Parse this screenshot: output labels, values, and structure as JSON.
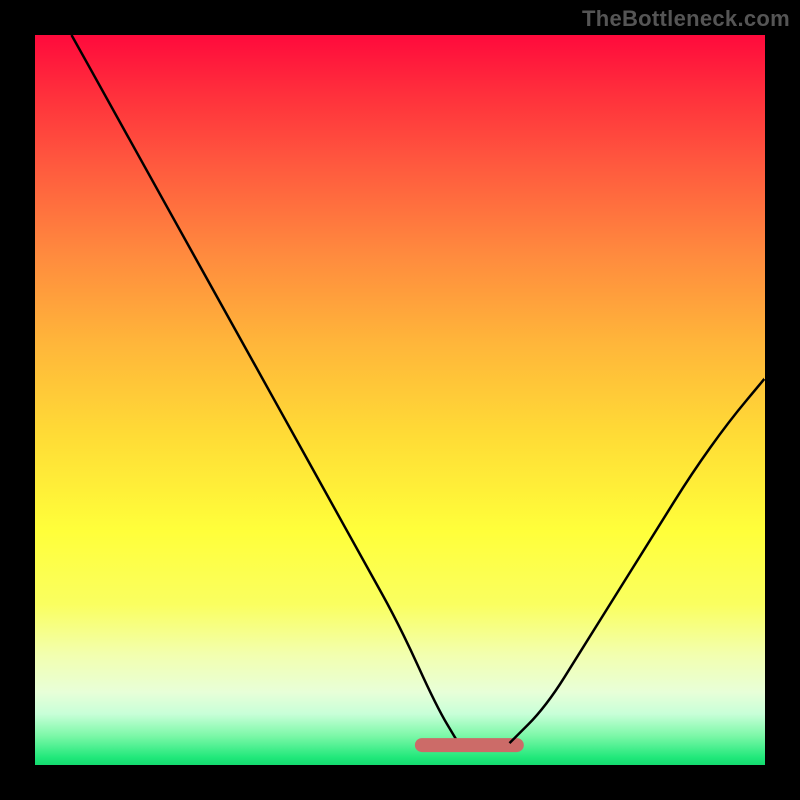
{
  "watermark": "TheBottleneck.com",
  "colors": {
    "gradient_top": "#ff0a3c",
    "gradient_bottom": "#14da6f",
    "valley_stroke": "#cc6b68",
    "curve_stroke": "#000000",
    "frame": "#000000"
  },
  "chart_data": {
    "type": "line",
    "title": "",
    "xlabel": "",
    "ylabel": "",
    "xlim": [
      0,
      100
    ],
    "ylim": [
      0,
      100
    ],
    "series": [
      {
        "name": "bottleneck-curve",
        "x": [
          5,
          10,
          15,
          20,
          25,
          30,
          35,
          40,
          45,
          50,
          55,
          58,
          62,
          65,
          70,
          75,
          80,
          85,
          90,
          95,
          100
        ],
        "y": [
          100,
          91,
          82,
          73,
          64,
          55,
          46,
          37,
          28,
          19,
          8,
          3,
          3,
          3,
          8,
          16,
          24,
          32,
          40,
          47,
          53
        ]
      }
    ],
    "annotations": [
      {
        "name": "valley-flat-region",
        "x_range": [
          53,
          66
        ],
        "y": 3
      }
    ],
    "background": "vertical-gradient-red-to-green",
    "grid": false,
    "legend": false
  }
}
